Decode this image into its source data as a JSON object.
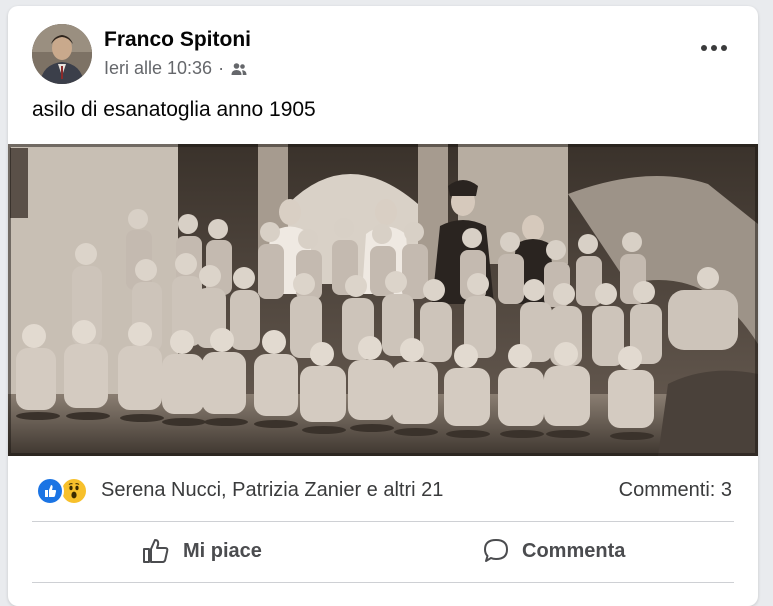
{
  "post": {
    "author": "Franco Spitoni",
    "timestamp": "Ieri alle 10:36",
    "separator": "·",
    "audience_icon": "friends-icon",
    "text": "asilo di esanatoglia anno 1905",
    "photo_description_icon": "photo"
  },
  "reactions": {
    "types": [
      "like",
      "wow"
    ],
    "summary": "Serena Nucci, Patrizia Zanier e altri 21",
    "comments": "Commenti: 3"
  },
  "actions": {
    "like_label": "Mi piace",
    "comment_label": "Commenta"
  },
  "colors": {
    "like_blue": "#1b74e4",
    "wow_yellow": "#f7c02b",
    "text_primary": "#050505",
    "text_secondary": "#65676b"
  }
}
